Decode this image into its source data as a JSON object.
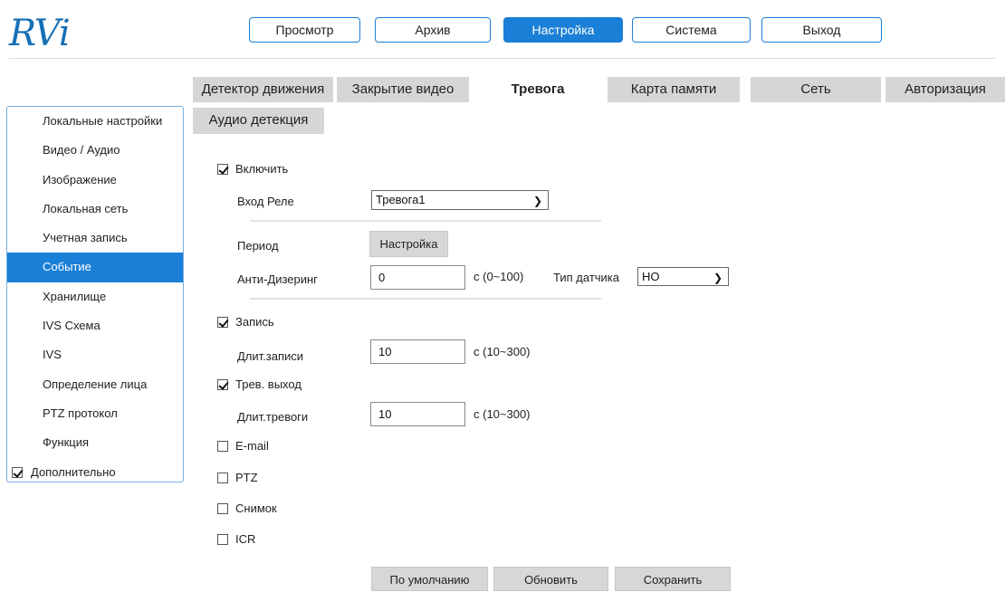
{
  "logo": "RVi",
  "topnav": [
    "Просмотр",
    "Архив",
    "Настройка",
    "Система",
    "Выход"
  ],
  "topnav_active": 2,
  "sidebar": {
    "items": [
      "Локальные настройки",
      "Видео / Аудио",
      "Изображение",
      "Локальная сеть",
      "Учетная запись",
      "Событие",
      "Хранилище",
      "IVS Схема",
      "IVS",
      "Определение лица",
      "PTZ протокол",
      "Функция"
    ],
    "active_index": 5,
    "advanced_label": "Дополнительно",
    "advanced_checked": true
  },
  "tabs": [
    "Детектор движения",
    "Закрытие видео",
    "Тревога",
    "Карта памяти",
    "Сеть",
    "Авторизация",
    "Аудио детекция"
  ],
  "tabs_active": 2,
  "form": {
    "enable_label": "Включить",
    "relay_input_label": "Вход Реле",
    "relay_input_value": "Тревога1",
    "period_label": "Период",
    "period_button": "Настройка",
    "antidither_label": "Анти-Дизеринг",
    "antidither_value": "0",
    "antidither_range": "с (0~100)",
    "sensor_type_label": "Тип датчика",
    "sensor_type_value": "НО",
    "record_label": "Запись",
    "record_duration_label": "Длит.записи",
    "record_duration_value": "10",
    "record_duration_range": "с (10~300)",
    "alarm_out_label": "Трев. выход",
    "alarm_duration_label": "Длит.тревоги",
    "alarm_duration_value": "10",
    "alarm_duration_range": "с (10~300)",
    "email_label": "E-mail",
    "ptz_label": "PTZ",
    "snapshot_label": "Снимок",
    "icr_label": "ICR"
  },
  "buttons": {
    "default": "По умолчанию",
    "refresh": "Обновить",
    "save": "Сохранить"
  },
  "colors": {
    "accent": "#1a7fd6",
    "tab_bg": "#d6d6d6",
    "button_bg": "#d7d7d7"
  }
}
